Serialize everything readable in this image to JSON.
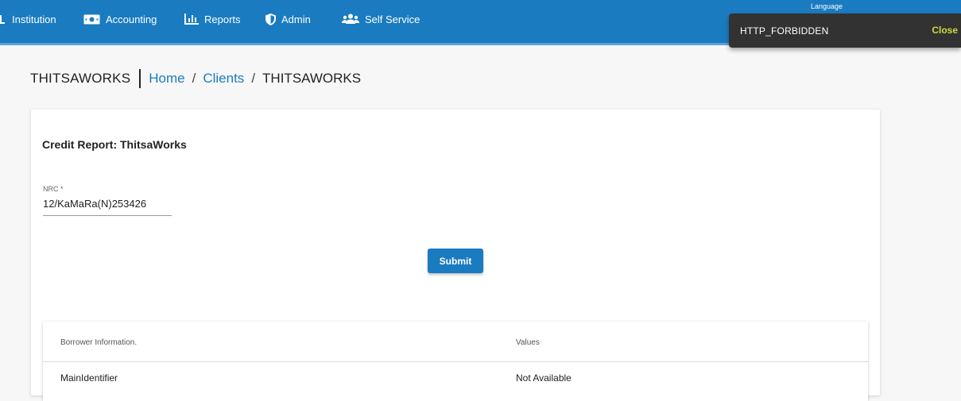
{
  "topnav": {
    "items": [
      {
        "label": "Institution",
        "icon": "institution-icon"
      },
      {
        "label": "Accounting",
        "icon": "money-icon"
      },
      {
        "label": "Reports",
        "icon": "bar-chart-icon"
      },
      {
        "label": "Admin",
        "icon": "shield-icon"
      },
      {
        "label": "Self Service",
        "icon": "users-icon"
      }
    ],
    "language_label": "Language"
  },
  "snackbar": {
    "message": "HTTP_FORBIDDEN",
    "action": "Close"
  },
  "header": {
    "title": "THITSAWORKS",
    "breadcrumb": {
      "home": "Home",
      "sep1": "/",
      "clients": "Clients",
      "sep2": "/",
      "current": "THITSAWORKS"
    }
  },
  "form": {
    "title": "Credit Report: ThitsaWorks",
    "nrc_label": "NRC *",
    "nrc_value": "12/KaMaRa(N)253426",
    "submit_label": "Submit"
  },
  "table": {
    "headers": [
      "Borrower Information.",
      "Values"
    ],
    "rows": [
      [
        "MainIdentifier",
        "Not Available"
      ]
    ]
  },
  "colors": {
    "primary": "#1a7bc1",
    "snackbar_bg": "#323232",
    "snackbar_action": "#cddc39"
  }
}
